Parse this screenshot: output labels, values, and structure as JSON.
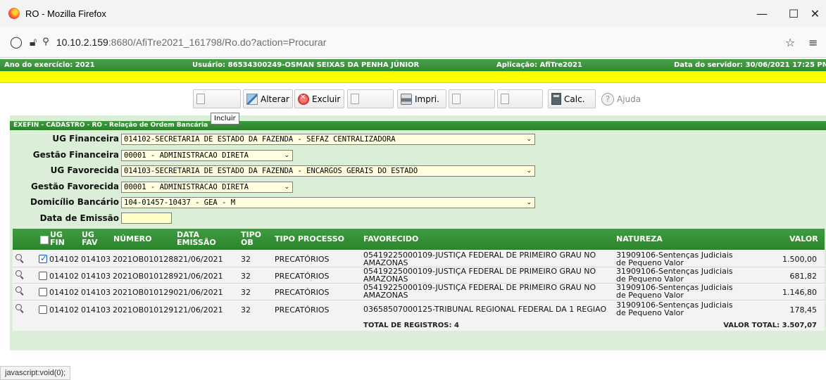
{
  "window": {
    "title": "RO - Mozilla Firefox"
  },
  "browser": {
    "url_host": "10.10.2.159",
    "url_rest": ":8680/AfiTre2021_161798/Ro.do?action=Procurar"
  },
  "header": {
    "year": "Ano do exercício: 2021",
    "user": "Usuário: 86534300249-OSMAN SEIXAS DA PENHA JÚNIOR",
    "app": "Aplicação: AfiTre2021",
    "server_date": "Data do servidor: 30/06/2021 17:25 PM"
  },
  "toolbar": {
    "alterar": "Alterar",
    "excluir": "Excluir",
    "imprimir": "Impri.",
    "calc": "Calc.",
    "ajuda": "Ajuda",
    "tooltip": "Incluir"
  },
  "form": {
    "title": "EXEFIN - CADASTRO - RO - Relação de Ordem Bancária",
    "ug_financeira": {
      "label": "UG Financeira",
      "value": "014102-SECRETARIA DE ESTADO DA FAZENDA - SEFAZ CENTRALIZADORA"
    },
    "gestao_financeira": {
      "label": "Gestão Financeira",
      "value": "00001 - ADMINISTRACAO DIRETA"
    },
    "ug_favorecida": {
      "label": "UG Favorecida",
      "value": "014103-SECRETARIA DE ESTADO DA FAZENDA - ENCARGOS GERAIS DO ESTADO"
    },
    "gestao_favorecida": {
      "label": "Gestão Favorecida",
      "value": "00001 - ADMINISTRACAO DIRETA"
    },
    "domicilio": {
      "label": "Domicílio Bancário",
      "value": "104-01457-10437 - GEA - M"
    },
    "data_emissao": {
      "label": "Data de Emissão",
      "value": ""
    }
  },
  "table": {
    "headers": {
      "ug_fin_1": "UG",
      "ug_fin_2": "FIN",
      "ug_fav_1": "UG",
      "ug_fav_2": "FAV",
      "numero": "NÚMERO",
      "data_1": "DATA",
      "data_2": "EMISSÃO",
      "tipo_1": "TIPO",
      "tipo_2": "OB",
      "tipo_processo": "TIPO PROCESSO",
      "favorecido": "FAVORECIDO",
      "natureza": "NATUREZA",
      "valor": "VALOR"
    },
    "rows": [
      {
        "checked": true,
        "ug_fin": "014102",
        "ug_fav": "014103",
        "numero": "2021OB010128821/06/2021",
        "tipo_ob": "32",
        "tipo_processo": "PRECATÓRIOS",
        "favorecido": "05419225000109-JUSTIÇA FEDERAL DE PRIMEIRO GRAU NO AMAZONAS",
        "natureza": "31909106-Sentenças Judiciais de Pequeno Valor",
        "valor": "1.500,00"
      },
      {
        "checked": false,
        "ug_fin": "014102",
        "ug_fav": "014103",
        "numero": "2021OB010128921/06/2021",
        "tipo_ob": "32",
        "tipo_processo": "PRECATÓRIOS",
        "favorecido": "05419225000109-JUSTIÇA FEDERAL DE PRIMEIRO GRAU NO AMAZONAS",
        "natureza": "31909106-Sentenças Judiciais de Pequeno Valor",
        "valor": "681,82"
      },
      {
        "checked": false,
        "ug_fin": "014102",
        "ug_fav": "014103",
        "numero": "2021OB010129021/06/2021",
        "tipo_ob": "32",
        "tipo_processo": "PRECATÓRIOS",
        "favorecido": "05419225000109-JUSTIÇA FEDERAL DE PRIMEIRO GRAU NO AMAZONAS",
        "natureza": "31909106-Sentenças Judiciais de Pequeno Valor",
        "valor": "1.146,80"
      },
      {
        "checked": false,
        "ug_fin": "014102",
        "ug_fav": "014103",
        "numero": "2021OB010129121/06/2021",
        "tipo_ob": "32",
        "tipo_processo": "PRECATÓRIOS",
        "favorecido": "03658507000125-TRIBUNAL REGIONAL FEDERAL DA 1 REGIAO",
        "natureza": "31909106-Sentenças Judiciais de Pequeno Valor",
        "valor": "178,45"
      }
    ],
    "total_registros": "TOTAL DE REGISTROS: 4",
    "valor_total": "VALOR TOTAL: 3.507,07"
  },
  "status": {
    "text": "javascript:void(0);"
  }
}
